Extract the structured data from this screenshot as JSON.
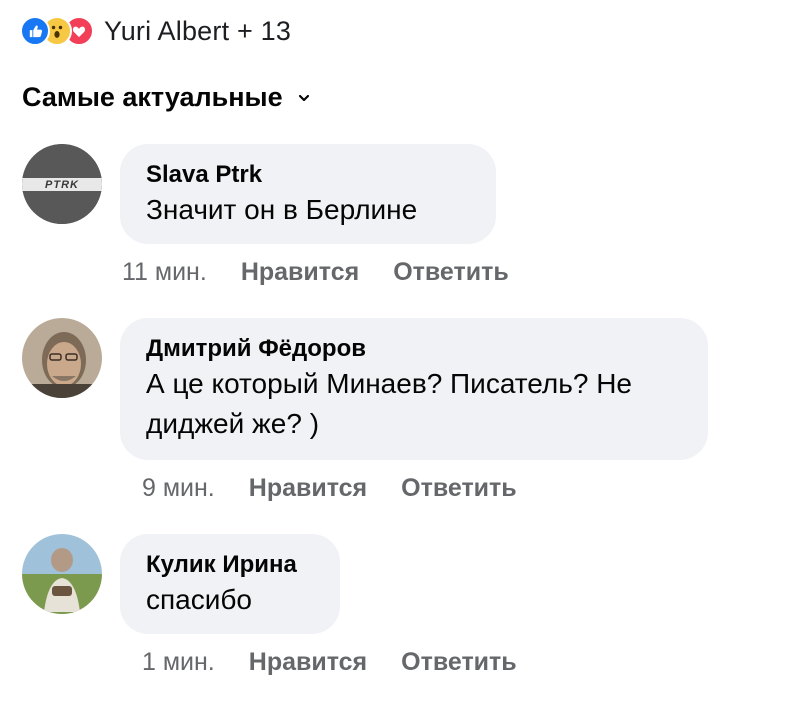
{
  "reactions": {
    "icons": [
      "like-icon",
      "wow-icon",
      "love-icon"
    ],
    "colors": {
      "like": "#1877f2",
      "wow": "#f7c843",
      "love": "#f33e58"
    },
    "summary": "Yuri Albert + 13"
  },
  "sort": {
    "label": "Самые актуальные",
    "icon": "chevron-down-icon"
  },
  "comments": [
    {
      "author": "Slava Ptrk",
      "avatar_text": "PTRK",
      "text_lines": [
        "Значит он в Берлине"
      ],
      "time": "11 мин.",
      "like": "Нравится",
      "reply": "Ответить"
    },
    {
      "author": "Дмитрий Фёдоров",
      "text_lines": [
        "А це который Минаев? Писатель? Не",
        "диджей же? )"
      ],
      "time": "9 мин.",
      "like": "Нравится",
      "reply": "Ответить"
    },
    {
      "author": "Кулик Ирина",
      "text_lines": [
        "спасибо"
      ],
      "time": "1 мин.",
      "like": "Нравится",
      "reply": "Ответить"
    }
  ]
}
